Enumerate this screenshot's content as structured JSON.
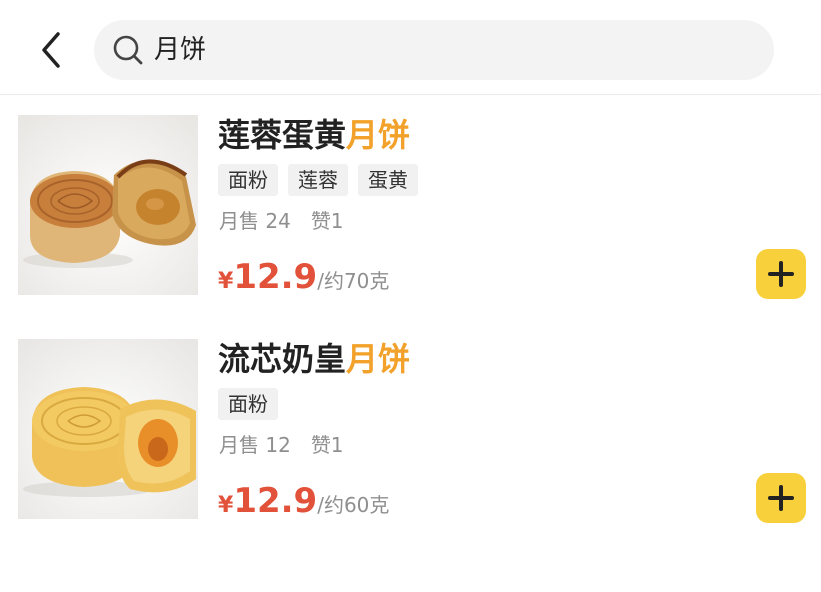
{
  "search": {
    "query": "月饼"
  },
  "icons": {
    "back": "chevron-left-icon",
    "search": "search-icon",
    "add": "plus-icon"
  },
  "colors": {
    "highlight": "#f2a12a",
    "price": "#e2513a",
    "add_button": "#f8d03b",
    "muted_text": "#8f8f8f",
    "tag_background": "#f1f1f1"
  },
  "products": [
    {
      "name_prefix": "莲蓉蛋黄",
      "name_highlight": "月饼",
      "tags": [
        "面粉",
        "莲蓉",
        "蛋黄"
      ],
      "sales": "月售 24",
      "likes": "赞1",
      "currency": "¥",
      "price": "12.9",
      "unit": "/约70克"
    },
    {
      "name_prefix": "流芯奶皇",
      "name_highlight": "月饼",
      "tags": [
        "面粉"
      ],
      "sales": "月售 12",
      "likes": "赞1",
      "currency": "¥",
      "price": "12.9",
      "unit": "/约60克"
    }
  ]
}
